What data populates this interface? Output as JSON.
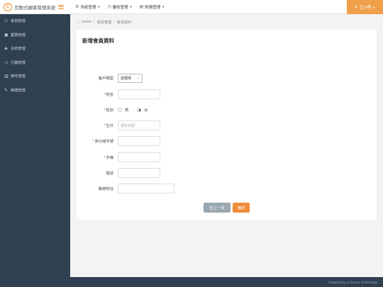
{
  "app": {
    "logo_char": "C",
    "title": "互動式顧客管理系統"
  },
  "top_menus": [
    {
      "icon": "gear-icon",
      "glyph": "⚙",
      "label": "系統管理"
    },
    {
      "icon": "clock-icon",
      "glyph": "◷",
      "label": "審核管理"
    },
    {
      "icon": "report-icon",
      "glyph": "▤",
      "label": "財務管理"
    }
  ],
  "user": {
    "icon": "user-icon",
    "glyph": "♙",
    "name": "王小明"
  },
  "sidebar": {
    "items": [
      {
        "icon": "members-icon",
        "glyph": "⚇",
        "label": "會員管理"
      },
      {
        "icon": "briefcase-icon",
        "glyph": "▣",
        "label": "業務管理"
      },
      {
        "icon": "layers-icon",
        "glyph": "◈",
        "label": "合約管理"
      },
      {
        "icon": "marketing-icon",
        "glyph": "◁",
        "label": "行銷管理"
      },
      {
        "icon": "building-icon",
        "glyph": "▥",
        "label": "物件管理"
      },
      {
        "icon": "wrench-icon",
        "glyph": "✎",
        "label": "維繕管理"
      }
    ]
  },
  "breadcrumb": {
    "home": "Home",
    "level1": "會員管理",
    "level2": "會員資料"
  },
  "form": {
    "title": "新增會員資料",
    "customer_type": {
      "label": "客戶類型",
      "value": "請選擇"
    },
    "name": {
      "label": "姓名",
      "value": ""
    },
    "gender": {
      "label": "性別",
      "options": [
        "男",
        "女"
      ],
      "selected": "女"
    },
    "birthday": {
      "label": "生日",
      "placeholder": "選取日期"
    },
    "id_number": {
      "label": "身分證字號",
      "value": ""
    },
    "mobile": {
      "label": "手機",
      "value": ""
    },
    "phone": {
      "label": "電話",
      "value": ""
    },
    "address": {
      "label": "聯絡地址",
      "value": ""
    },
    "back_button": "回上一頁",
    "confirm_button": "確認"
  },
  "footer": {
    "text": "Powered by co-house Technology"
  },
  "colors": {
    "accent": "#f0a04b",
    "sidebar_bg": "#2f4050",
    "confirm": "#f08c3a",
    "back": "#9aa7b0"
  }
}
